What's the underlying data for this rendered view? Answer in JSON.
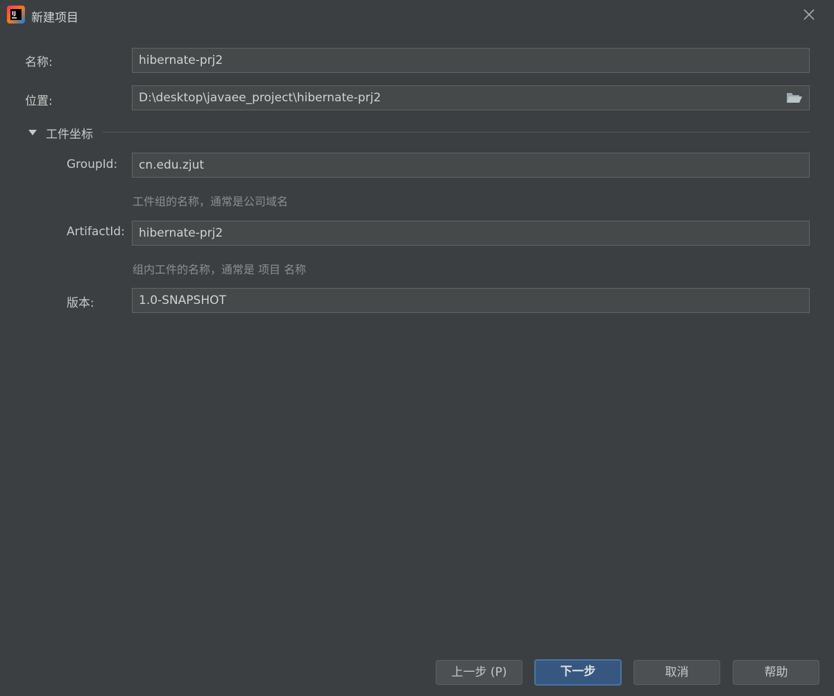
{
  "window": {
    "title": "新建项目",
    "app_icon": "intellij-idea-icon",
    "close_icon": "close-icon"
  },
  "form": {
    "name_label": "名称:",
    "name_value": "hibernate-prj2",
    "location_label": "位置:",
    "location_value": "D:\\desktop\\javaee_project\\hibernate-prj2",
    "folder_icon": "folder-open-icon"
  },
  "artifact_section": {
    "title": "工件坐标",
    "toggle_icon": "triangle-down-icon",
    "groupid_label": "GroupId:",
    "groupid_value": "cn.edu.zjut",
    "groupid_hint": "工件组的名称，通常是公司域名",
    "artifactid_label": "ArtifactId:",
    "artifactid_value": "hibernate-prj2",
    "artifactid_hint": "组内工件的名称，通常是 项目 名称",
    "version_label": "版本:",
    "version_value": "1.0-SNAPSHOT"
  },
  "buttons": {
    "previous": "上一步 (P)",
    "next": "下一步",
    "cancel": "取消",
    "help": "帮助"
  },
  "colors": {
    "background": "#3c3f41",
    "field_background": "#45494a",
    "primary_button": "#365880"
  }
}
